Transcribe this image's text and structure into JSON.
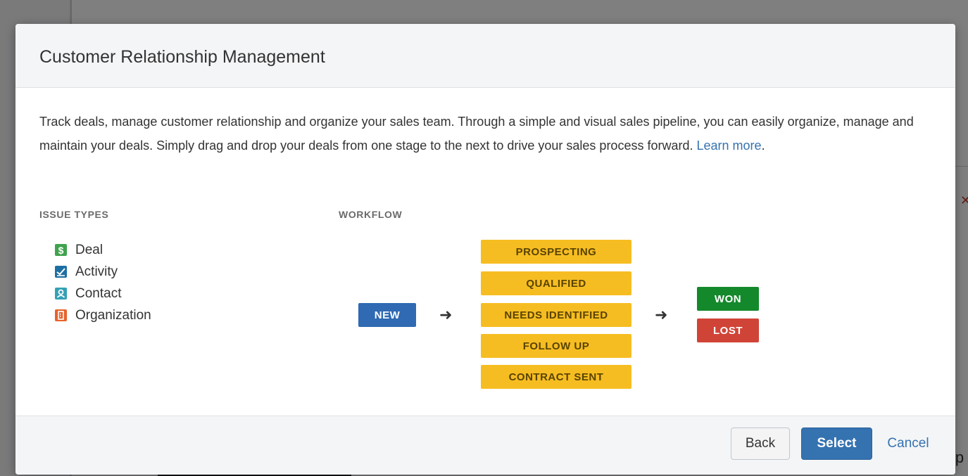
{
  "dialog": {
    "title": "Customer Relationship Management",
    "description": "Track deals, manage customer relationship and organize your sales team. Through a simple and visual sales pipeline, you can easily organize, manage and maintain your deals. Simply drag and drop your deals from one stage to the next to drive your sales process forward.",
    "learn_more": "Learn more",
    "after_link": "."
  },
  "issue_types": {
    "label": "ISSUE TYPES",
    "items": [
      {
        "label": "Deal",
        "icon": "dollar-icon",
        "color": "#3fa34d"
      },
      {
        "label": "Activity",
        "icon": "activity-icon",
        "color": "#1d6fa3"
      },
      {
        "label": "Contact",
        "icon": "contact-icon",
        "color": "#33a1b5"
      },
      {
        "label": "Organization",
        "icon": "organization-icon",
        "color": "#e8632b"
      }
    ]
  },
  "workflow": {
    "label": "WORKFLOW",
    "start": {
      "label": "NEW",
      "color": "#2f6ab3"
    },
    "stages": [
      "PROSPECTING",
      "QUALIFIED",
      "NEEDS IDENTIFIED",
      "FOLLOW UP",
      "CONTRACT SENT"
    ],
    "stage_color": "#f6bd22",
    "outcomes": [
      {
        "label": "WON",
        "color": "#14892c"
      },
      {
        "label": "LOST",
        "color": "#d04437"
      }
    ]
  },
  "footer": {
    "back": "Back",
    "select": "Select",
    "cancel": "Cancel"
  },
  "background": {
    "partial_text": "ip"
  }
}
